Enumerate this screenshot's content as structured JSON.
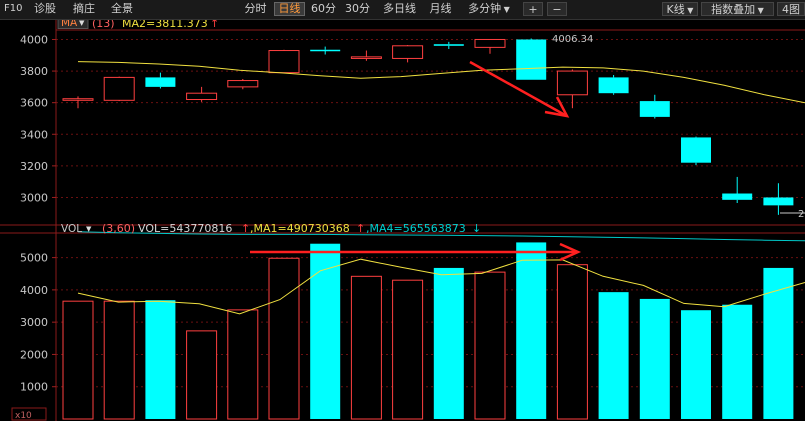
{
  "toolbar": {
    "left_items": [
      "F10",
      "诊股",
      "摘庄",
      "全景"
    ],
    "period_tabs": [
      "分时",
      "日线",
      "60分",
      "30分",
      "多日线",
      "月线"
    ],
    "active_tab": "日线",
    "more_minutes": "多分钟",
    "plus": "+",
    "minus": "−",
    "kline_menu": "K线",
    "index_overlay": "指数叠加",
    "multi_chart": "4图"
  },
  "price_panel": {
    "indicator_name": "MA",
    "ma_params": "(13)",
    "ma_label": "MA2=3811.373",
    "ma_arrow": "↑",
    "high_label": "4006.34",
    "low_label": "2",
    "y_ticks": [
      "4000",
      "3800",
      "3600",
      "3400",
      "3200",
      "3000"
    ],
    "ylim": [
      2870,
      4060
    ],
    "up_color": "#ff4040",
    "down_color": "#00ffff",
    "ma_color": "#f0e040"
  },
  "volume_panel": {
    "indicator_name": "VOL",
    "params": "(3,60)",
    "vol_label": "VOL=543770816",
    "vol_arrow": "↑",
    "ma1_label": ",MA1=490730368",
    "ma1_arrow": "↑",
    "ma4_label": ",MA4=565563873",
    "ma4_arrow": "↓",
    "unit_label": "x10",
    "y_ticks": [
      "5000",
      "4000",
      "3000",
      "2000",
      "1000"
    ],
    "ylim": [
      0,
      5700
    ],
    "ma1_color": "#f0e040",
    "ma4_color": "#00c8c8"
  },
  "chart_data": {
    "type": "candlestick",
    "candles": [
      {
        "open": 3615,
        "close": 3625,
        "high": 3640,
        "low": 3565,
        "up": true
      },
      {
        "open": 3615,
        "close": 3760,
        "high": 3765,
        "low": 3610,
        "up": true
      },
      {
        "open": 3760,
        "close": 3700,
        "high": 3790,
        "low": 3690,
        "up": false
      },
      {
        "open": 3620,
        "close": 3660,
        "high": 3700,
        "low": 3605,
        "up": true
      },
      {
        "open": 3700,
        "close": 3740,
        "high": 3750,
        "low": 3685,
        "up": true
      },
      {
        "open": 3790,
        "close": 3930,
        "high": 3935,
        "low": 3785,
        "up": true
      },
      {
        "open": 3935,
        "close": 3930,
        "high": 3955,
        "low": 3905,
        "up": false
      },
      {
        "open": 3880,
        "close": 3890,
        "high": 3930,
        "low": 3865,
        "up": true
      },
      {
        "open": 3880,
        "close": 3960,
        "high": 3965,
        "low": 3855,
        "up": true
      },
      {
        "open": 3970,
        "close": 3960,
        "high": 3985,
        "low": 3940,
        "up": false
      },
      {
        "open": 3950,
        "close": 4000,
        "high": 4000,
        "low": 3910,
        "up": true
      },
      {
        "open": 4000,
        "close": 3745,
        "high": 4006.34,
        "low": 3745,
        "up": false
      },
      {
        "open": 3650,
        "close": 3800,
        "high": 3810,
        "low": 3565,
        "up": true
      },
      {
        "open": 3760,
        "close": 3660,
        "high": 3775,
        "low": 3650,
        "up": false
      },
      {
        "open": 3610,
        "close": 3510,
        "high": 3650,
        "low": 3500,
        "up": false
      },
      {
        "open": 3380,
        "close": 3220,
        "high": 3385,
        "low": 3205,
        "up": false
      },
      {
        "open": 3025,
        "close": 2985,
        "high": 3130,
        "low": 2965,
        "up": false
      },
      {
        "open": 3000,
        "close": 2950,
        "high": 3090,
        "low": 2890,
        "up": false
      }
    ],
    "ma13": [
      3860,
      3855,
      3845,
      3830,
      3805,
      3790,
      3770,
      3755,
      3765,
      3785,
      3805,
      3815,
      3825,
      3820,
      3800,
      3760,
      3710,
      3650,
      3600
    ],
    "volume": [
      3650,
      3650,
      3680,
      2730,
      3380,
      4980,
      5430,
      4420,
      4300,
      4680,
      4550,
      5470,
      4780,
      3930,
      3720,
      3370,
      3540,
      4680
    ],
    "vol_ma1": [
      3900,
      3620,
      3650,
      3570,
      3260,
      3700,
      4590,
      4950,
      4700,
      4470,
      4510,
      4920,
      4930,
      4420,
      4140,
      3580,
      3480,
      3870,
      4230
    ],
    "vol_ma4": [
      5800,
      5770,
      5750,
      5730,
      5720,
      5720,
      5720,
      5710,
      5700,
      5690,
      5680,
      5670,
      5650,
      5630,
      5610,
      5590,
      5560,
      5540,
      5520
    ],
    "price_ylim": [
      2870,
      4060
    ],
    "volume_ylim": [
      0,
      5700
    ]
  }
}
